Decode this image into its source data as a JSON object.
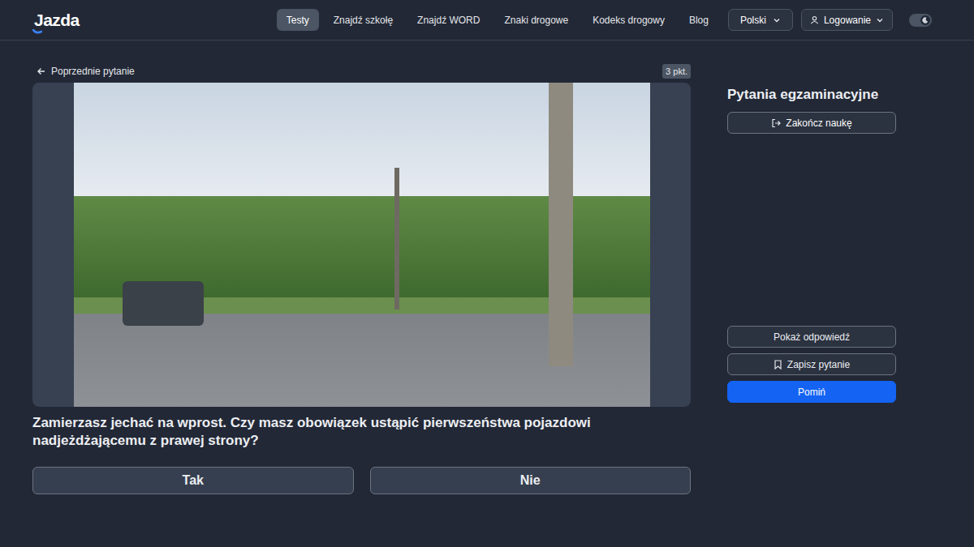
{
  "header": {
    "logo": "Jazda",
    "nav": [
      {
        "label": "Testy",
        "selected": true
      },
      {
        "label": "Znajdź szkołę",
        "selected": false
      },
      {
        "label": "Znajdź WORD",
        "selected": false
      },
      {
        "label": "Znaki drogowe",
        "selected": false
      },
      {
        "label": "Kodeks drogowy",
        "selected": false
      },
      {
        "label": "Blog",
        "selected": false
      }
    ],
    "language": "Polski",
    "login": "Logowanie",
    "dark_mode": {
      "on": true
    }
  },
  "question": {
    "back": "Poprzednie pytanie",
    "points": "3 pkt.",
    "text": "Zamierzasz jechać na wprost. Czy masz obowiązek ustąpić pierwszeństwa pojazdowi nadjeżdżającemu z prawej strony?",
    "answers": [
      {
        "label": "Tak",
        "selected": false
      },
      {
        "label": "Nie",
        "selected": false
      }
    ]
  },
  "sidebar": {
    "title": "Pytania egzaminacyjne",
    "end": "Zakończ naukę",
    "actions": [
      {
        "label": "Pokaż odpowiedź",
        "kind": "plain"
      },
      {
        "label": "Zapisz pytanie",
        "kind": "bookmark"
      },
      {
        "label": "Pomiń",
        "kind": "primary"
      }
    ]
  }
}
